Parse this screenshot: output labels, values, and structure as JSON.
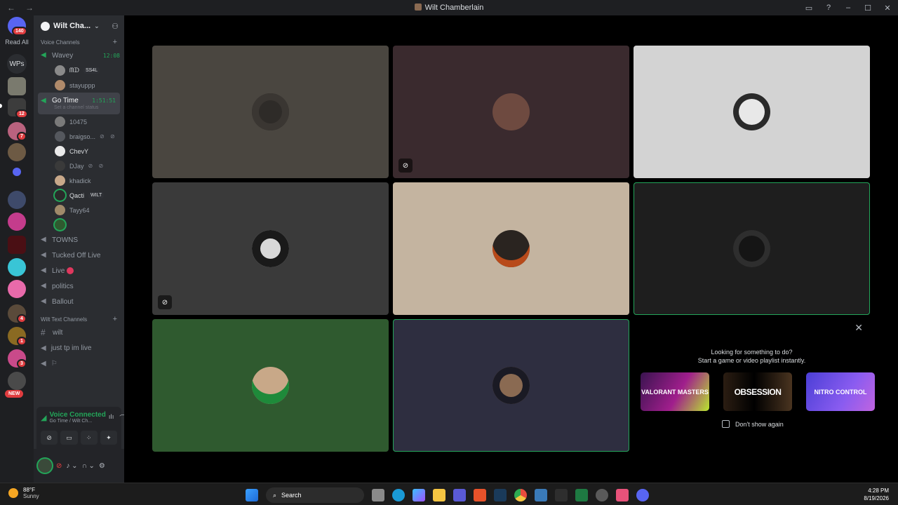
{
  "window": {
    "title": "Wilt Chamberlain",
    "back": "←",
    "forward": "→",
    "inbox_icon": "inbox-icon",
    "help_icon": "help-icon",
    "min": "–",
    "max": "☐",
    "close": "✕"
  },
  "rail": {
    "home_badge": "140",
    "read_all": "Read All",
    "wps": "WPs",
    "badges": {
      "b1": "12",
      "b2": "7",
      "b3": "4",
      "b4": "1",
      "b5": "3"
    },
    "new_label": "NEW"
  },
  "server": {
    "name": "Wilt Cha...",
    "chevron": "⌄",
    "invite_icon": "add-member-icon"
  },
  "voice_category": {
    "label": "Voice Channels",
    "plus": "+"
  },
  "channels": {
    "wavey": {
      "name": "Wavey",
      "time": "12:08"
    },
    "wavey_members": [
      {
        "name": "ᗰᗪ",
        "tag": "SS4L"
      },
      {
        "name": "stayuppp"
      }
    ],
    "gotime": {
      "name": "Go Time",
      "time": "1:51:51",
      "status": "Set a channel status"
    },
    "gotime_members": [
      {
        "name": "10475"
      },
      {
        "name": "braigso...",
        "icons": "⊘ ⊘"
      },
      {
        "name": "ChevY"
      },
      {
        "name": "DJay",
        "icons": "⊘ ⊘"
      },
      {
        "name": "khadick"
      },
      {
        "name": "Qacti",
        "tag": "WILT"
      },
      {
        "name": "Tayy64"
      }
    ],
    "others": [
      "TOWNS",
      "Tucked Off Live",
      "Live",
      "politics",
      "Ballout"
    ]
  },
  "text_category": {
    "label": "Wilt Text Channels",
    "plus": "+"
  },
  "text_channels": [
    "wilt",
    "just tp im live",
    ""
  ],
  "voice_panel": {
    "status": "Voice Connected",
    "location": "Go Time / Wilt Ch...",
    "buttons": [
      "⊘",
      "▭",
      "⁘",
      "✦"
    ]
  },
  "user_panel": {
    "mic": "🎙",
    "headphones": "🎧",
    "settings": "⚙"
  },
  "activity": {
    "line1": "Looking for something to do?",
    "line2": "Start a game or video playlist instantly.",
    "cards": [
      "VALORANT MASTERS",
      "OBSESSION",
      "NITRO CONTROL"
    ],
    "dont_show": "Don't show again"
  },
  "taskbar": {
    "temp": "88°F",
    "condition": "Sunny",
    "search": "Search",
    "time": "4:28 PM",
    "date": "8/19/2026"
  },
  "colors": {
    "speaking": "#23a559",
    "badge": "#e03c3f",
    "sidebar": "#2b2d31",
    "rail": "#1e1f22"
  }
}
